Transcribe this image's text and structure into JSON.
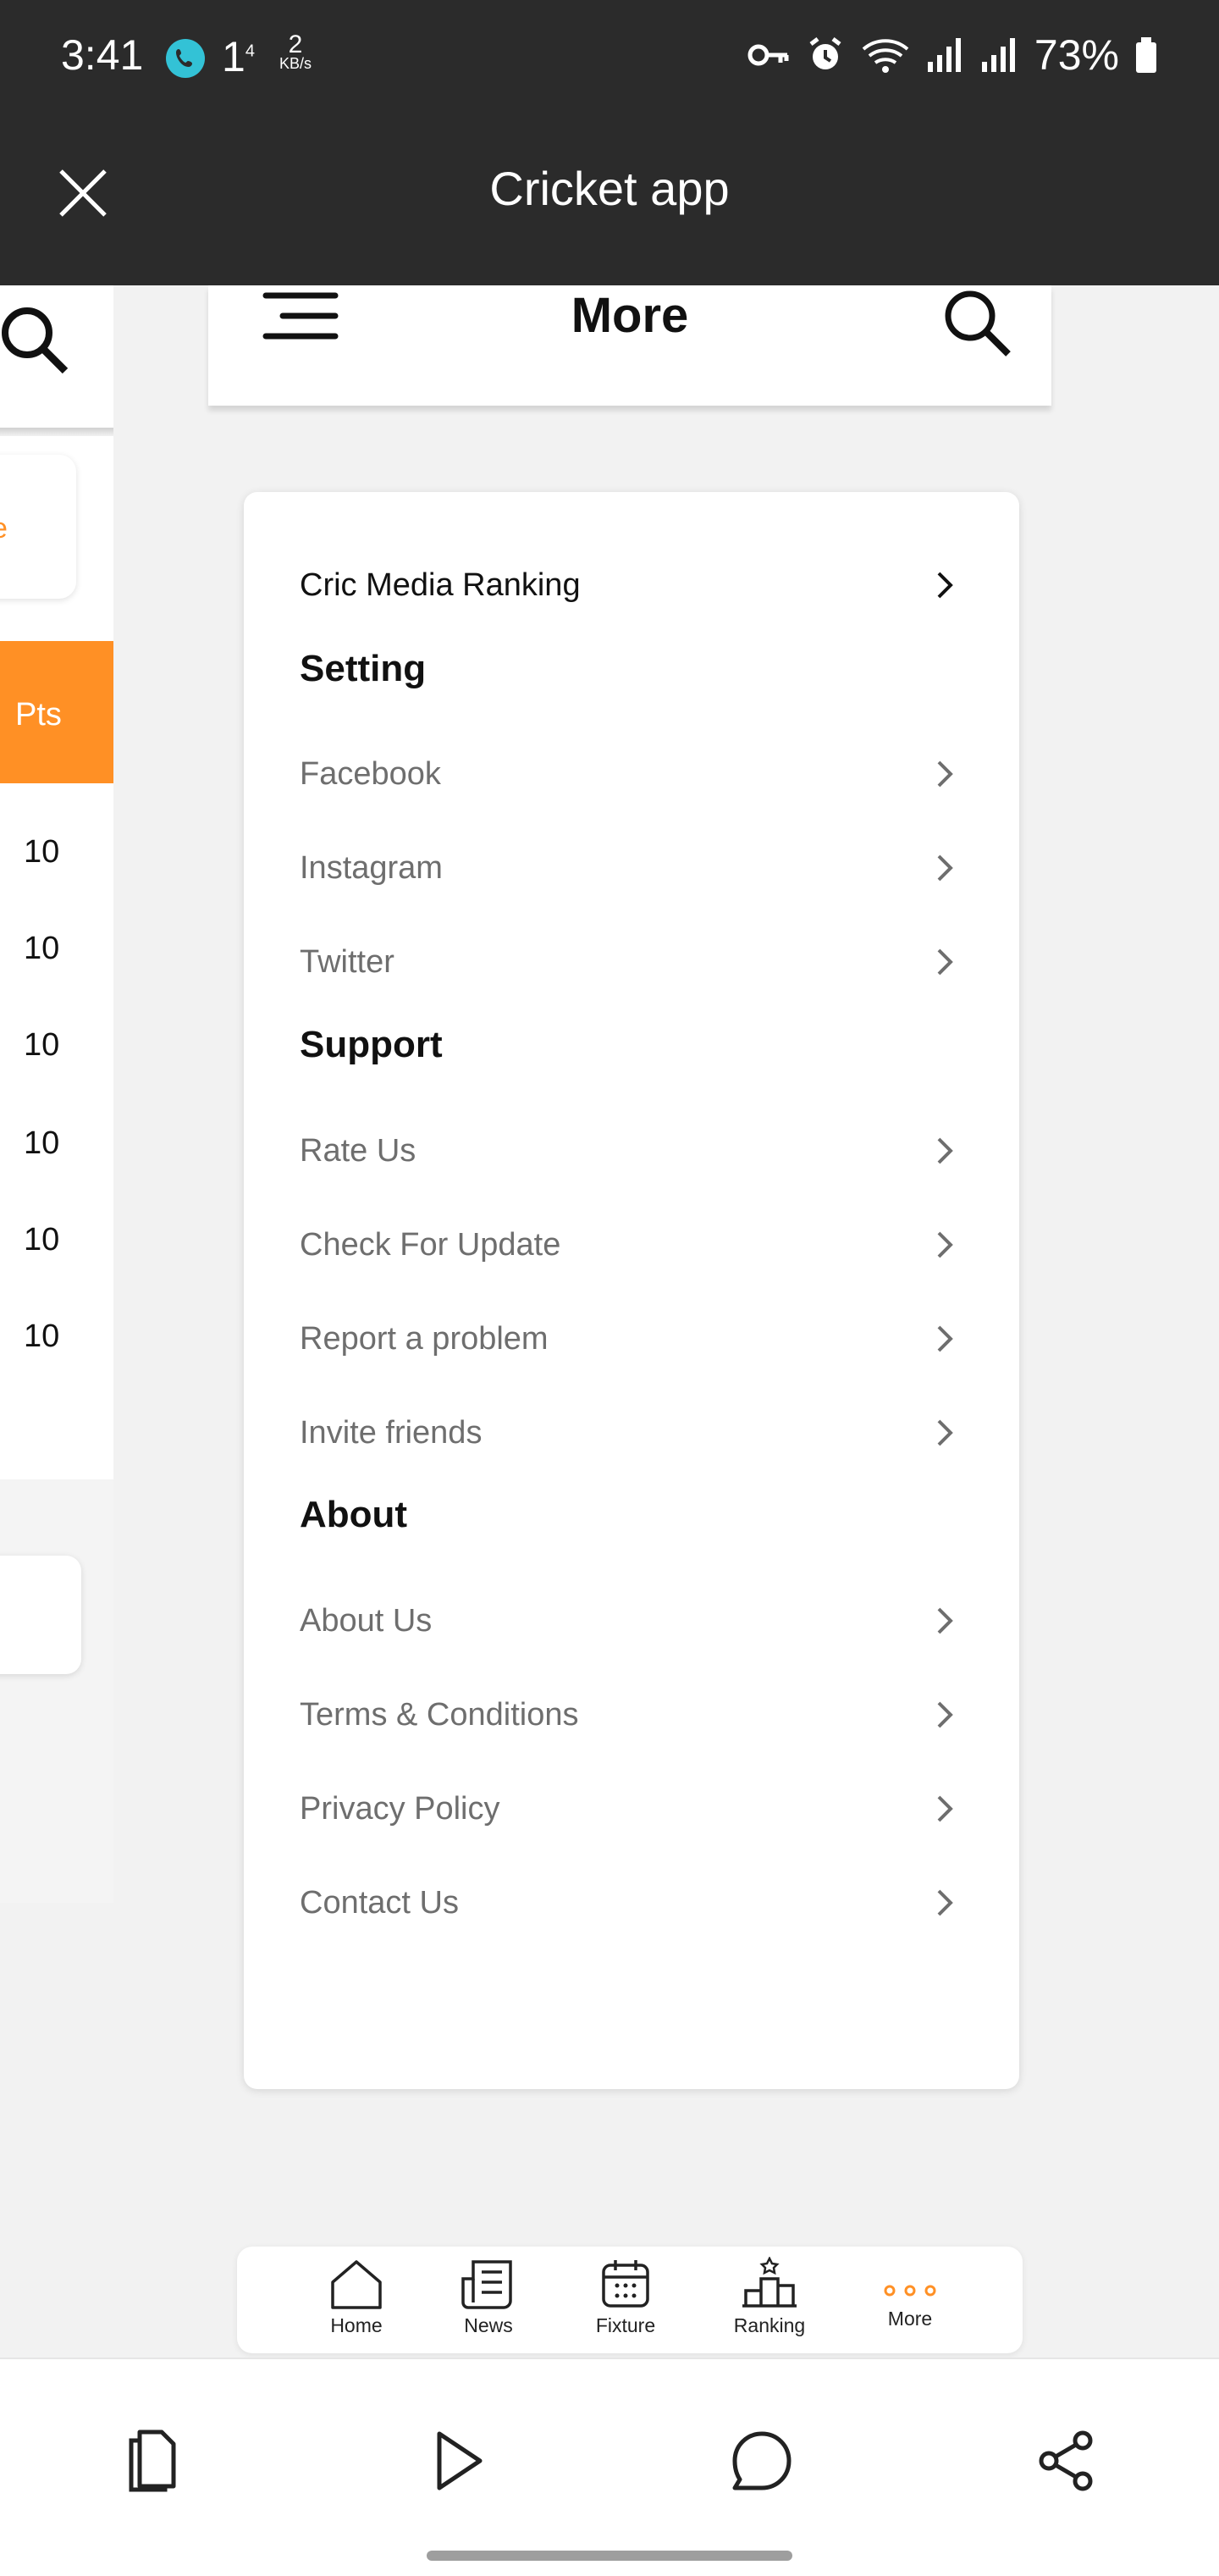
{
  "status_bar": {
    "time": "3:41",
    "one_indicator": "1",
    "one_sup": "4",
    "net_speed_value": "2",
    "net_speed_unit": "KB/s",
    "battery": "73%"
  },
  "title_bar": {
    "title": "Cricket app"
  },
  "background_page": {
    "pts_label": "Pts",
    "pts_values": [
      "10",
      "10",
      "10",
      "10",
      "10",
      "10"
    ],
    "orange_fragment": "e"
  },
  "header": {
    "title": "More"
  },
  "menu": {
    "top_item": "Cric Media Ranking",
    "setting_title": "Setting",
    "setting_items": [
      "Facebook",
      "Instagram",
      "Twitter"
    ],
    "support_title": "Support",
    "support_items": [
      "Rate Us",
      "Check For Update",
      "Report a problem",
      "Invite friends"
    ],
    "about_title": "About",
    "about_items": [
      "About Us",
      "Terms & Conditions",
      "Privacy Policy",
      "Contact Us"
    ]
  },
  "tabbar": {
    "active_color": "#ff9025",
    "tabs": [
      "Home",
      "News",
      "Fixture",
      "Ranking",
      "More"
    ]
  },
  "colors": {
    "accent": "#ff9025",
    "topbar": "#2b2b2b"
  }
}
